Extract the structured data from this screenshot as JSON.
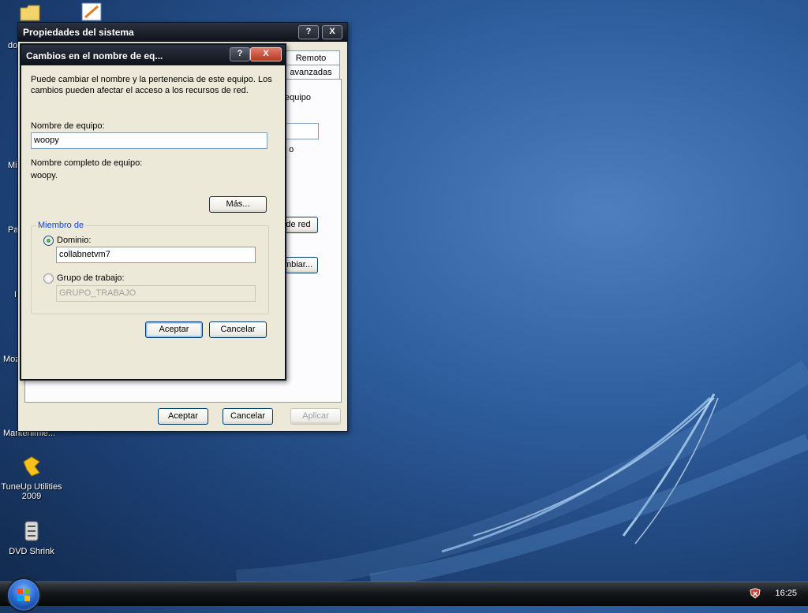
{
  "desktop": {
    "icons": [
      {
        "label": "TuneUp Utilities 2009",
        "icon": "tuneup-icon"
      },
      {
        "label": "DVD Shrink",
        "icon": "dvd-shrink-icon"
      }
    ],
    "clipped_labels": [
      "do",
      "Mis",
      "Pa",
      "I",
      "Moz",
      "Mantenimie..."
    ]
  },
  "system_properties": {
    "title": "Propiedades del sistema",
    "help_btn": "?",
    "close_btn": "X",
    "tabs": [
      "Remoto",
      "avanzadas"
    ],
    "clipped_text": [
      "equipo",
      "' o",
      "de red",
      "mbiar..."
    ],
    "buttons": {
      "ok": "Aceptar",
      "cancel": "Cancelar",
      "apply": "Aplicar"
    }
  },
  "rename_dialog": {
    "title": "Cambios en el nombre de eq...",
    "help_btn": "?",
    "close_btn": "X",
    "description": "Puede cambiar el nombre y la pertenencia de este equipo. Los cambios pueden afectar el acceso a los recursos de red.",
    "computer_name_label": "Nombre de equipo:",
    "computer_name_value": "woopy",
    "full_name_label": "Nombre completo de equipo:",
    "full_name_value": "woopy.",
    "more_button": "Más...",
    "member_of_label": "Miembro de",
    "domain_label": "Dominio:",
    "domain_value": "collabnetvm7",
    "workgroup_label": "Grupo de trabajo:",
    "workgroup_value": "GRUPO_TRABAJO",
    "domain_selected": true,
    "buttons": {
      "ok": "Aceptar",
      "cancel": "Cancelar"
    }
  },
  "taskbar": {
    "clock": "16:25",
    "tray_icons": [
      "security-shield-icon"
    ]
  },
  "colors": {
    "accent": "#0046d5",
    "titlebar": "#0e1219"
  }
}
